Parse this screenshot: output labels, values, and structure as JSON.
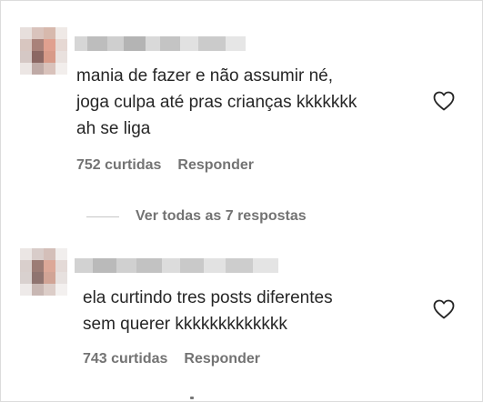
{
  "comments": [
    {
      "text": "mania de fazer e não assumir né,\njoga culpa até pras crianças kkkkkkk\nah se liga",
      "likes": "752 curtidas",
      "reply_label": "Responder"
    },
    {
      "text": "ela curtindo tres posts diferentes\nsem querer kkkkkkkkkkkkk",
      "likes": "743 curtidas",
      "reply_label": "Responder"
    }
  ],
  "view_replies": "Ver todas as 7 respostas",
  "colors": {
    "text": "#262626",
    "secondary": "#737373",
    "divider": "#c7c7c7"
  },
  "icons": [
    "heart-icon",
    "avatar"
  ]
}
